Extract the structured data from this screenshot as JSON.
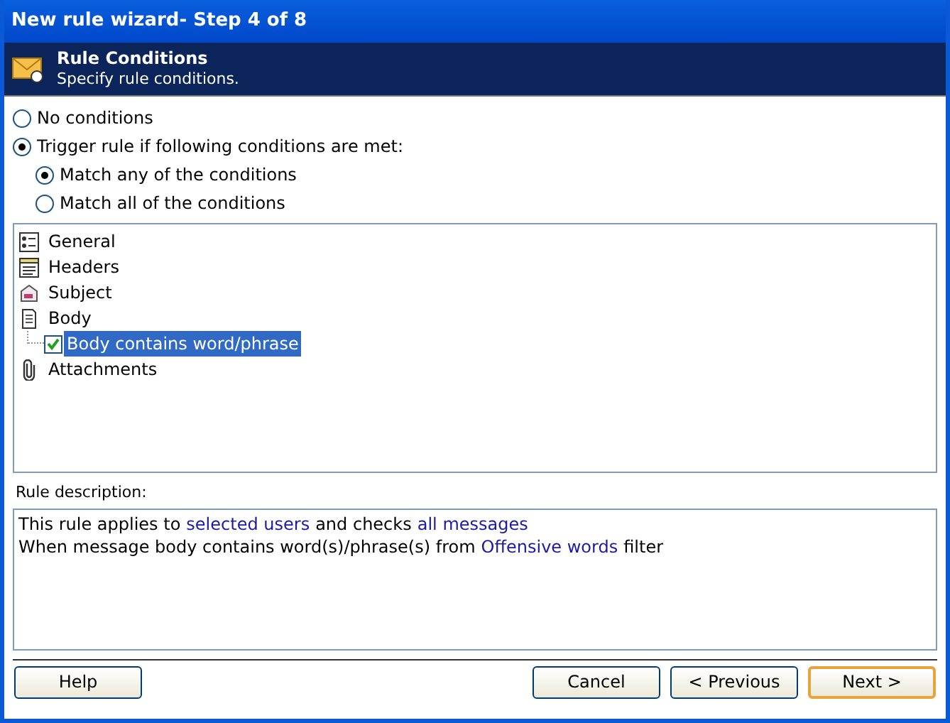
{
  "window": {
    "title": "New rule wizard- Step 4 of 8"
  },
  "header": {
    "title": "Rule Conditions",
    "subtitle": "Specify rule conditions."
  },
  "options": [
    {
      "label": "No conditions",
      "selected": false
    },
    {
      "label": "Trigger rule if following conditions are met:",
      "selected": true,
      "children": [
        {
          "label": "Match any of the conditions",
          "selected": true
        },
        {
          "label": "Match all of the conditions",
          "selected": false
        }
      ]
    }
  ],
  "tree": [
    {
      "label": "General",
      "kind": "general",
      "selected": false
    },
    {
      "label": "Headers",
      "kind": "headers",
      "selected": false
    },
    {
      "label": "Subject",
      "kind": "subject",
      "selected": false
    },
    {
      "label": "Body",
      "kind": "body",
      "selected": false,
      "children": [
        {
          "label": "Body contains word/phrase",
          "checked": true,
          "selected": true
        }
      ]
    },
    {
      "label": "Attachments",
      "kind": "attachments",
      "selected": false
    }
  ],
  "description": {
    "label": "Rule description:",
    "lines": [
      [
        {
          "kind": "text",
          "text": "This rule applies to"
        },
        {
          "kind": "link",
          "text": "selected users"
        },
        {
          "kind": "text",
          "text": "and checks"
        },
        {
          "kind": "link",
          "text": "all messages"
        }
      ],
      [
        {
          "kind": "text",
          "text": "When message body contains word(s)/phrase(s) from"
        },
        {
          "kind": "link",
          "text": "Offensive words"
        },
        {
          "kind": "text",
          "text": "filter"
        }
      ]
    ]
  },
  "buttons": {
    "left": [
      {
        "label": "Help",
        "focused": false
      }
    ],
    "right": [
      {
        "label": "Cancel",
        "focused": false
      },
      {
        "label": "< Previous",
        "focused": false
      },
      {
        "label": "Next >",
        "focused": true
      }
    ]
  }
}
